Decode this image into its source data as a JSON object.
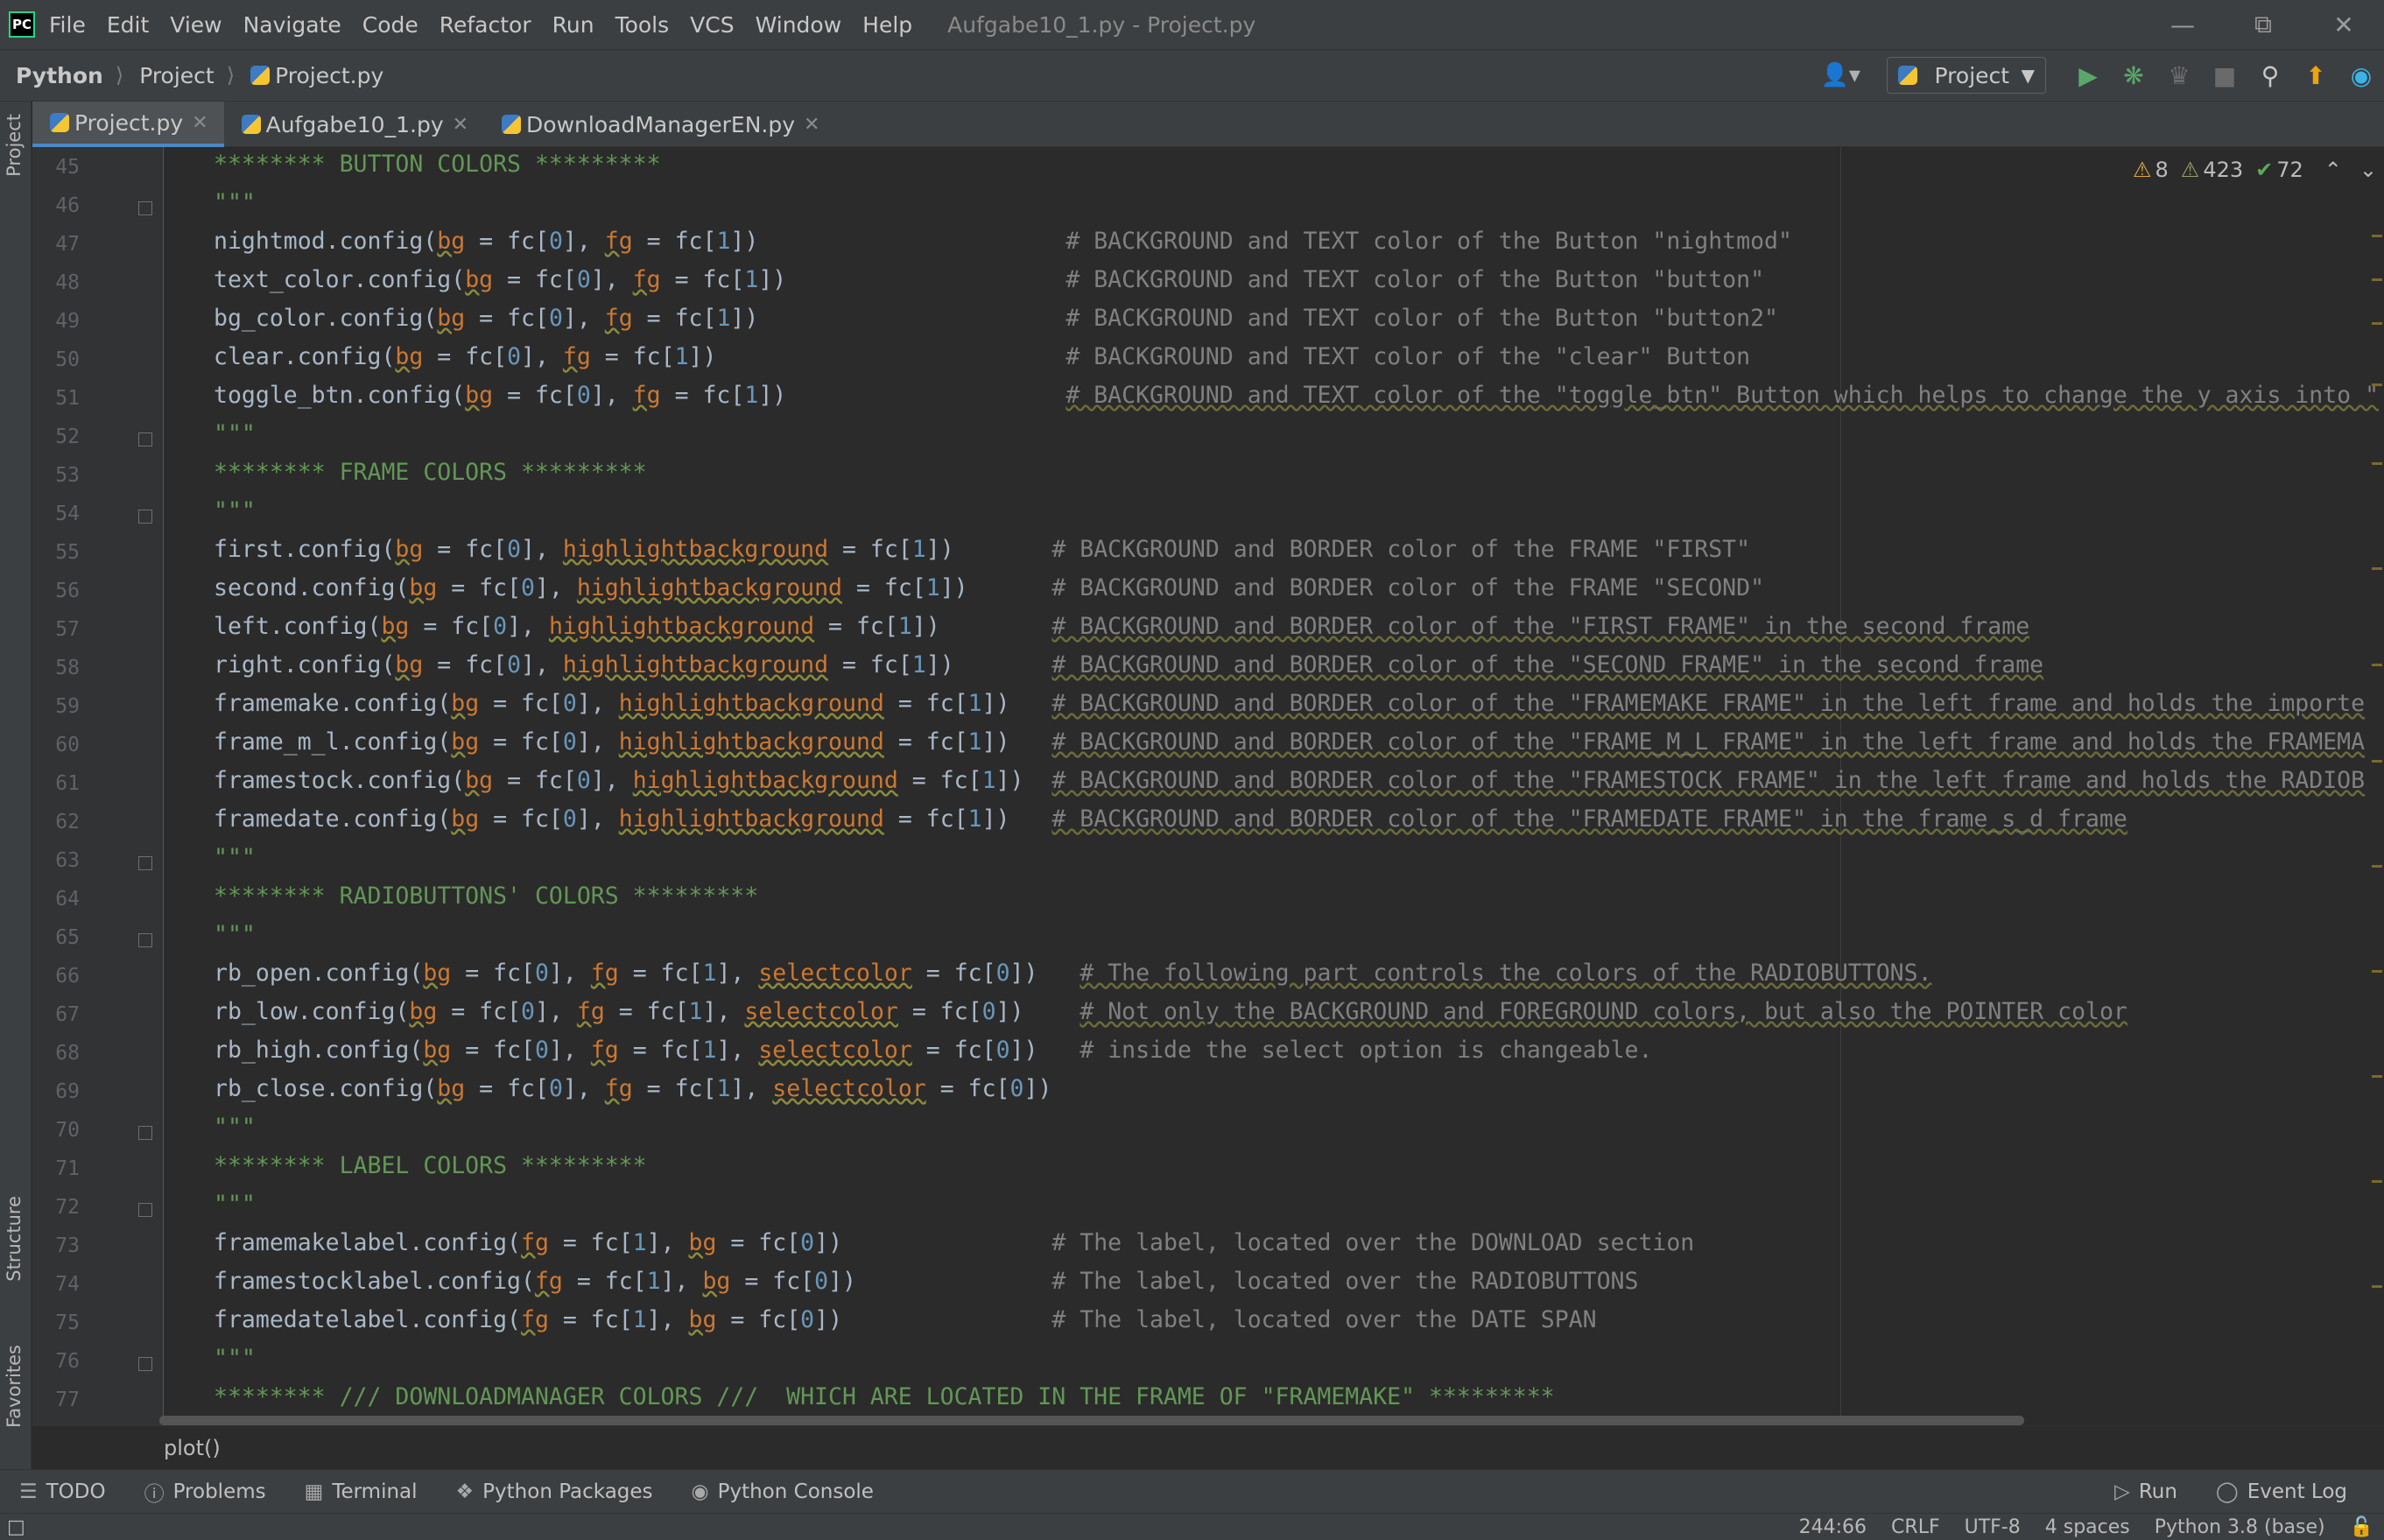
{
  "app": {
    "logo_text": "PC",
    "menu": [
      "File",
      "Edit",
      "View",
      "Navigate",
      "Code",
      "Refactor",
      "Run",
      "Tools",
      "VCS",
      "Window",
      "Help"
    ],
    "window_title": "Aufgabe10_1.py - Project.py"
  },
  "navbar": {
    "crumbs": [
      "Python",
      "Project",
      "Project.py"
    ],
    "run_config": "Project"
  },
  "left_strip": {
    "project_tab": "Project",
    "structure_tab": "Structure",
    "favorites_tab": "Favorites"
  },
  "tabs": [
    {
      "label": "Project.py",
      "active": true
    },
    {
      "label": "Aufgabe10_1.py",
      "active": false
    },
    {
      "label": "DownloadManagerEN.py",
      "active": false
    }
  ],
  "inspections": {
    "warnings": "8",
    "weak_warnings": "423",
    "typos": "72"
  },
  "colors": {
    "comment": "#808080",
    "docstring": "#629755",
    "number": "#6897bb",
    "keyword_arg": "#cc7832",
    "text": "#a9b7c6"
  },
  "code": {
    "lines": [
      {
        "n": 45,
        "segs": [
          [
            "d",
            "******** BUTTON COLORS *********"
          ]
        ]
      },
      {
        "n": 46,
        "fold": true,
        "segs": [
          [
            "d",
            "\"\"\""
          ]
        ]
      },
      {
        "n": 47,
        "segs": [
          [
            "p",
            "nightmod.config("
          ],
          [
            "k",
            "bg"
          ],
          [
            "p",
            " = fc["
          ],
          [
            "n",
            "0"
          ],
          [
            "p",
            "], "
          ],
          [
            "k",
            "fg"
          ],
          [
            "p",
            " = fc["
          ],
          [
            "n",
            "1"
          ],
          [
            "p",
            "])                      "
          ],
          [
            "c",
            "# BACKGROUND and TEXT color of the Button \"nightmod\""
          ]
        ]
      },
      {
        "n": 48,
        "segs": [
          [
            "p",
            "text_color.config("
          ],
          [
            "k",
            "bg"
          ],
          [
            "p",
            " = fc["
          ],
          [
            "n",
            "0"
          ],
          [
            "p",
            "], "
          ],
          [
            "k",
            "fg"
          ],
          [
            "p",
            " = fc["
          ],
          [
            "n",
            "1"
          ],
          [
            "p",
            "])                    "
          ],
          [
            "c",
            "# BACKGROUND and TEXT color of the Button \"button\""
          ]
        ]
      },
      {
        "n": 49,
        "segs": [
          [
            "p",
            "bg_color.config("
          ],
          [
            "k",
            "bg"
          ],
          [
            "p",
            " = fc["
          ],
          [
            "n",
            "0"
          ],
          [
            "p",
            "], "
          ],
          [
            "k",
            "fg"
          ],
          [
            "p",
            " = fc["
          ],
          [
            "n",
            "1"
          ],
          [
            "p",
            "])                      "
          ],
          [
            "c",
            "# BACKGROUND and TEXT color of the Button \"button2\""
          ]
        ]
      },
      {
        "n": 50,
        "segs": [
          [
            "p",
            "clear.config("
          ],
          [
            "k",
            "bg"
          ],
          [
            "p",
            " = fc["
          ],
          [
            "n",
            "0"
          ],
          [
            "p",
            "], "
          ],
          [
            "k",
            "fg"
          ],
          [
            "p",
            " = fc["
          ],
          [
            "n",
            "1"
          ],
          [
            "p",
            "])                         "
          ],
          [
            "c",
            "# BACKGROUND and TEXT color of the \"clear\" Button"
          ]
        ]
      },
      {
        "n": 51,
        "segs": [
          [
            "p",
            "toggle_btn.config("
          ],
          [
            "k",
            "bg"
          ],
          [
            "p",
            " = fc["
          ],
          [
            "n",
            "0"
          ],
          [
            "p",
            "], "
          ],
          [
            "k",
            "fg"
          ],
          [
            "p",
            " = fc["
          ],
          [
            "n",
            "1"
          ],
          [
            "p",
            "])                    "
          ],
          [
            "cu",
            "# BACKGROUND and TEXT color of the \"toggle_btn\" Button which helps to change the y axis into \""
          ]
        ]
      },
      {
        "n": 52,
        "fold": true,
        "segs": [
          [
            "d",
            "\"\"\""
          ]
        ]
      },
      {
        "n": 53,
        "segs": [
          [
            "d",
            "******** FRAME COLORS *********"
          ]
        ]
      },
      {
        "n": 54,
        "fold": true,
        "segs": [
          [
            "d",
            "\"\"\""
          ]
        ]
      },
      {
        "n": 55,
        "segs": [
          [
            "p",
            "first.config("
          ],
          [
            "k",
            "bg"
          ],
          [
            "p",
            " = fc["
          ],
          [
            "n",
            "0"
          ],
          [
            "p",
            "], "
          ],
          [
            "k",
            "highlightbackground"
          ],
          [
            "p",
            " = fc["
          ],
          [
            "n",
            "1"
          ],
          [
            "p",
            "])       "
          ],
          [
            "c",
            "# BACKGROUND and BORDER color of the FRAME \"FIRST\""
          ]
        ]
      },
      {
        "n": 56,
        "segs": [
          [
            "p",
            "second.config("
          ],
          [
            "k",
            "bg"
          ],
          [
            "p",
            " = fc["
          ],
          [
            "n",
            "0"
          ],
          [
            "p",
            "], "
          ],
          [
            "k",
            "highlightbackground"
          ],
          [
            "p",
            " = fc["
          ],
          [
            "n",
            "1"
          ],
          [
            "p",
            "])      "
          ],
          [
            "c",
            "# BACKGROUND and BORDER color of the FRAME \"SECOND\""
          ]
        ]
      },
      {
        "n": 57,
        "segs": [
          [
            "p",
            "left.config("
          ],
          [
            "k",
            "bg"
          ],
          [
            "p",
            " = fc["
          ],
          [
            "n",
            "0"
          ],
          [
            "p",
            "], "
          ],
          [
            "k",
            "highlightbackground"
          ],
          [
            "p",
            " = fc["
          ],
          [
            "n",
            "1"
          ],
          [
            "p",
            "])        "
          ],
          [
            "cu",
            "# BACKGROUND and BORDER color of the \"FIRST FRAME\" in the second frame"
          ]
        ]
      },
      {
        "n": 58,
        "segs": [
          [
            "p",
            "right.config("
          ],
          [
            "k",
            "bg"
          ],
          [
            "p",
            " = fc["
          ],
          [
            "n",
            "0"
          ],
          [
            "p",
            "], "
          ],
          [
            "k",
            "highlightbackground"
          ],
          [
            "p",
            " = fc["
          ],
          [
            "n",
            "1"
          ],
          [
            "p",
            "])       "
          ],
          [
            "cu",
            "# BACKGROUND and BORDER color of the \"SECOND FRAME\" in the second frame"
          ]
        ]
      },
      {
        "n": 59,
        "segs": [
          [
            "p",
            "framemake.config("
          ],
          [
            "k",
            "bg"
          ],
          [
            "p",
            " = fc["
          ],
          [
            "n",
            "0"
          ],
          [
            "p",
            "], "
          ],
          [
            "k",
            "highlightbackground"
          ],
          [
            "p",
            " = fc["
          ],
          [
            "n",
            "1"
          ],
          [
            "p",
            "])   "
          ],
          [
            "cu",
            "# BACKGROUND and BORDER color of the \"FRAMEMAKE FRAME\" in the left frame and holds the importe"
          ]
        ]
      },
      {
        "n": 60,
        "segs": [
          [
            "p",
            "frame_m_l.config("
          ],
          [
            "k",
            "bg"
          ],
          [
            "p",
            " = fc["
          ],
          [
            "n",
            "0"
          ],
          [
            "p",
            "], "
          ],
          [
            "k",
            "highlightbackground"
          ],
          [
            "p",
            " = fc["
          ],
          [
            "n",
            "1"
          ],
          [
            "p",
            "])   "
          ],
          [
            "cu",
            "# BACKGROUND and BORDER color of the \"FRAME_M_L FRAME\" in the left frame and holds the FRAMEMA"
          ]
        ]
      },
      {
        "n": 61,
        "segs": [
          [
            "p",
            "framestock.config("
          ],
          [
            "k",
            "bg"
          ],
          [
            "p",
            " = fc["
          ],
          [
            "n",
            "0"
          ],
          [
            "p",
            "], "
          ],
          [
            "k",
            "highlightbackground"
          ],
          [
            "p",
            " = fc["
          ],
          [
            "n",
            "1"
          ],
          [
            "p",
            "])  "
          ],
          [
            "cu",
            "# BACKGROUND and BORDER color of the \"FRAMESTOCK FRAME\" in the left frame and holds the RADIOB"
          ]
        ]
      },
      {
        "n": 62,
        "segs": [
          [
            "p",
            "framedate.config("
          ],
          [
            "k",
            "bg"
          ],
          [
            "p",
            " = fc["
          ],
          [
            "n",
            "0"
          ],
          [
            "p",
            "], "
          ],
          [
            "k",
            "highlightbackground"
          ],
          [
            "p",
            " = fc["
          ],
          [
            "n",
            "1"
          ],
          [
            "p",
            "])   "
          ],
          [
            "cu",
            "# BACKGROUND and BORDER color of the \"FRAMEDATE FRAME\" in the frame_s_d frame"
          ]
        ]
      },
      {
        "n": 63,
        "fold": true,
        "segs": [
          [
            "d",
            "\"\"\""
          ]
        ]
      },
      {
        "n": 64,
        "segs": [
          [
            "d",
            "******** RADIOBUTTONS' COLORS *********"
          ]
        ]
      },
      {
        "n": 65,
        "fold": true,
        "segs": [
          [
            "d",
            "\"\"\""
          ]
        ]
      },
      {
        "n": 66,
        "segs": [
          [
            "p",
            "rb_open.config("
          ],
          [
            "k",
            "bg"
          ],
          [
            "p",
            " = fc["
          ],
          [
            "n",
            "0"
          ],
          [
            "p",
            "], "
          ],
          [
            "k",
            "fg"
          ],
          [
            "p",
            " = fc["
          ],
          [
            "n",
            "1"
          ],
          [
            "p",
            "], "
          ],
          [
            "k",
            "selectcolor"
          ],
          [
            "p",
            " = fc["
          ],
          [
            "n",
            "0"
          ],
          [
            "p",
            "])   "
          ],
          [
            "cu",
            "# The following part controls the colors of the RADIOBUTTONS."
          ]
        ]
      },
      {
        "n": 67,
        "segs": [
          [
            "p",
            "rb_low.config("
          ],
          [
            "k",
            "bg"
          ],
          [
            "p",
            " = fc["
          ],
          [
            "n",
            "0"
          ],
          [
            "p",
            "], "
          ],
          [
            "k",
            "fg"
          ],
          [
            "p",
            " = fc["
          ],
          [
            "n",
            "1"
          ],
          [
            "p",
            "], "
          ],
          [
            "k",
            "selectcolor"
          ],
          [
            "p",
            " = fc["
          ],
          [
            "n",
            "0"
          ],
          [
            "p",
            "])    "
          ],
          [
            "cu",
            "# Not only the BACKGROUND and FOREGROUND colors, but also the POINTER color"
          ]
        ]
      },
      {
        "n": 68,
        "segs": [
          [
            "p",
            "rb_high.config("
          ],
          [
            "k",
            "bg"
          ],
          [
            "p",
            " = fc["
          ],
          [
            "n",
            "0"
          ],
          [
            "p",
            "], "
          ],
          [
            "k",
            "fg"
          ],
          [
            "p",
            " = fc["
          ],
          [
            "n",
            "1"
          ],
          [
            "p",
            "], "
          ],
          [
            "k",
            "selectcolor"
          ],
          [
            "p",
            " = fc["
          ],
          [
            "n",
            "0"
          ],
          [
            "p",
            "])   "
          ],
          [
            "c",
            "# inside the select option is changeable."
          ]
        ]
      },
      {
        "n": 69,
        "segs": [
          [
            "p",
            "rb_close.config("
          ],
          [
            "k",
            "bg"
          ],
          [
            "p",
            " = fc["
          ],
          [
            "n",
            "0"
          ],
          [
            "p",
            "], "
          ],
          [
            "k",
            "fg"
          ],
          [
            "p",
            " = fc["
          ],
          [
            "n",
            "1"
          ],
          [
            "p",
            "], "
          ],
          [
            "k",
            "selectcolor"
          ],
          [
            "p",
            " = fc["
          ],
          [
            "n",
            "0"
          ],
          [
            "p",
            "])"
          ]
        ]
      },
      {
        "n": 70,
        "fold": true,
        "segs": [
          [
            "d",
            "\"\"\""
          ]
        ]
      },
      {
        "n": 71,
        "segs": [
          [
            "d",
            "******** LABEL COLORS *********"
          ]
        ]
      },
      {
        "n": 72,
        "fold": true,
        "segs": [
          [
            "d",
            "\"\"\""
          ]
        ]
      },
      {
        "n": 73,
        "segs": [
          [
            "p",
            "framemakelabel.config("
          ],
          [
            "k",
            "fg"
          ],
          [
            "p",
            " = fc["
          ],
          [
            "n",
            "1"
          ],
          [
            "p",
            "], "
          ],
          [
            "k",
            "bg"
          ],
          [
            "p",
            " = fc["
          ],
          [
            "n",
            "0"
          ],
          [
            "p",
            "])               "
          ],
          [
            "c",
            "# The label, located over the DOWNLOAD section"
          ]
        ]
      },
      {
        "n": 74,
        "segs": [
          [
            "p",
            "framestocklabel.config("
          ],
          [
            "k",
            "fg"
          ],
          [
            "p",
            " = fc["
          ],
          [
            "n",
            "1"
          ],
          [
            "p",
            "], "
          ],
          [
            "k",
            "bg"
          ],
          [
            "p",
            " = fc["
          ],
          [
            "n",
            "0"
          ],
          [
            "p",
            "])              "
          ],
          [
            "c",
            "# The label, located over the RADIOBUTTONS"
          ]
        ]
      },
      {
        "n": 75,
        "segs": [
          [
            "p",
            "framedatelabel.config("
          ],
          [
            "k",
            "fg"
          ],
          [
            "p",
            " = fc["
          ],
          [
            "n",
            "1"
          ],
          [
            "p",
            "], "
          ],
          [
            "k",
            "bg"
          ],
          [
            "p",
            " = fc["
          ],
          [
            "n",
            "0"
          ],
          [
            "p",
            "])               "
          ],
          [
            "c",
            "# The label, located over the DATE SPAN"
          ]
        ]
      },
      {
        "n": 76,
        "fold": true,
        "segs": [
          [
            "d",
            "\"\"\""
          ]
        ]
      },
      {
        "n": 77,
        "segs": [
          [
            "d",
            "******** /// DOWNLOADMANAGER COLORS ///  WHICH ARE LOCATED IN THE FRAME OF \"FRAMEMAKE\" *********"
          ]
        ]
      }
    ]
  },
  "breadcrumb_func": "plot()",
  "tool_windows": {
    "todo": "TODO",
    "problems": "Problems",
    "terminal": "Terminal",
    "packages": "Python Packages",
    "console": "Python Console",
    "run": "Run",
    "event_log": "Event Log"
  },
  "status": {
    "position": "244:66",
    "line_sep": "CRLF",
    "encoding": "UTF-8",
    "indent": "4 spaces",
    "interpreter": "Python 3.8 (base)"
  }
}
